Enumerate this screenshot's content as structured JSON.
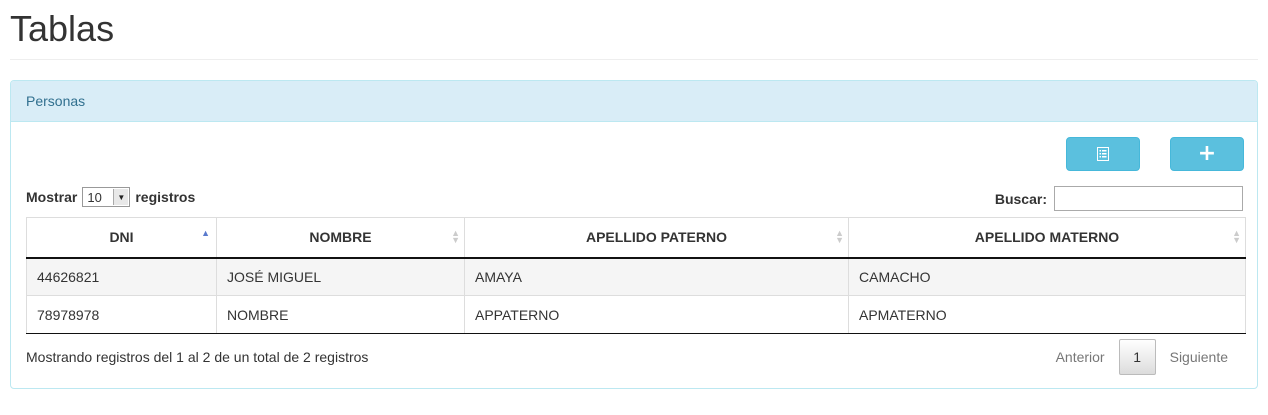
{
  "page": {
    "title": "Tablas"
  },
  "panel": {
    "heading": "Personas",
    "buttons": {
      "list_icon": "list-icon",
      "add_icon": "plus-icon",
      "add_glyph": "+"
    },
    "length": {
      "label_before": "Mostrar",
      "value": "10",
      "label_after": "registros"
    },
    "search": {
      "label": "Buscar:",
      "value": "",
      "placeholder": ""
    },
    "table": {
      "columns": [
        "DNI",
        "NOMBRE",
        "APELLIDO PATERNO",
        "APELLIDO MATERNO"
      ],
      "rows": [
        [
          "44626821",
          "JOSÉ MIGUEL",
          "AMAYA",
          "CAMACHO"
        ],
        [
          "78978978",
          "NOMBRE",
          "APPATERNO",
          "APMATERNO"
        ]
      ]
    },
    "info": "Mostrando registros del 1 al 2 de un total de 2 registros",
    "pagination": {
      "previous": "Anterior",
      "current": "1",
      "next": "Siguiente"
    }
  },
  "colors": {
    "panel_heading_bg": "#d9edf7",
    "panel_border": "#bce8f1",
    "button_info": "#5bc0de",
    "heading_text": "#31708f"
  }
}
